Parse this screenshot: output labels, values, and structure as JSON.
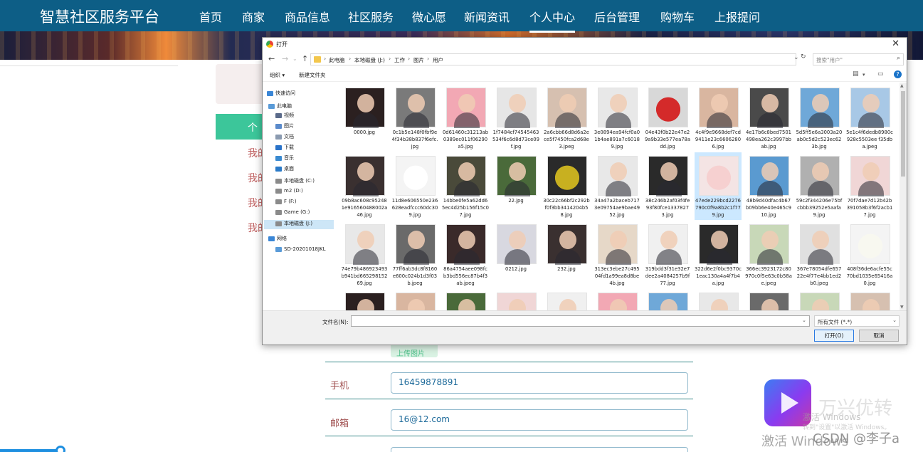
{
  "site": {
    "logo": "智慧社区服务平台",
    "nav": [
      "首页",
      "商家",
      "商品信息",
      "社区服务",
      "微心愿",
      "新闻资讯",
      "个人中心",
      "后台管理",
      "购物车",
      "上报提问"
    ],
    "active_nav": "个人中心",
    "side_green_label": "个",
    "side_links": [
      "我的",
      "我的",
      "我的",
      "我的"
    ],
    "upload_label": "上传图片",
    "form": [
      {
        "label": "手机",
        "value": "16459878891"
      },
      {
        "label": "邮箱",
        "value": "16@12.com"
      }
    ]
  },
  "dialog": {
    "title": "打开",
    "breadcrumb": [
      "此电脑",
      "本地磁盘 (J:)",
      "工作",
      "图片",
      "用户"
    ],
    "search_placeholder": "搜索\"用户\"",
    "toolbar": {
      "organize": "组织 ▾",
      "new_folder": "新建文件夹"
    },
    "nav_pane": [
      {
        "label": "快速访问",
        "icon": "star-icon",
        "color": "#3a86d6"
      },
      {
        "label": "此电脑",
        "icon": "computer-icon",
        "color": "#5a9bd8"
      },
      {
        "label": "视频",
        "icon": "video-icon",
        "color": "#5a6a8a"
      },
      {
        "label": "图片",
        "icon": "picture-icon",
        "color": "#5a8acb"
      },
      {
        "label": "文档",
        "icon": "document-icon",
        "color": "#8a9ab0"
      },
      {
        "label": "下载",
        "icon": "download-icon",
        "color": "#2a73c9"
      },
      {
        "label": "音乐",
        "icon": "music-icon",
        "color": "#3a8ad0"
      },
      {
        "label": "桌面",
        "icon": "desktop-icon",
        "color": "#2a7ac8"
      },
      {
        "label": "本地磁盘 (C:)",
        "icon": "drive-icon",
        "color": "#8a8a8a"
      },
      {
        "label": "m2 (D:)",
        "icon": "drive-icon",
        "color": "#8a8a8a"
      },
      {
        "label": "F (F:)",
        "icon": "drive-icon",
        "color": "#8a8a8a"
      },
      {
        "label": "Game (G:)",
        "icon": "drive-icon",
        "color": "#8a8a8a"
      },
      {
        "label": "本地磁盘 (J:)",
        "icon": "drive-icon",
        "color": "#8a8a8a"
      },
      {
        "label": "网络",
        "icon": "network-icon",
        "color": "#3a86d6"
      },
      {
        "label": "SD-20201018JKL",
        "icon": "computer-icon",
        "color": "#5a9bd8"
      }
    ],
    "selected_nav_index": 12,
    "files": [
      {
        "name": "0000.jpg",
        "color": "#2b2020"
      },
      {
        "name": "0c1b5e148f0fbf9e4f34b38b837f6efc.jpg",
        "color": "#7a7a7a"
      },
      {
        "name": "0d61460c31213ab0389ec011f06290a5.jpg",
        "color": "#f2a8b4"
      },
      {
        "name": "1f7484cf74545463534f6c6d8d73ce09f.jpg",
        "color": "#e6e6e6"
      },
      {
        "name": "2a6cbb66d8d6a2ece5f7450fca2d68e3.jpeg",
        "color": "#d6c0b0"
      },
      {
        "name": "3e0894ea94fcf0a01b4ae891a7c60189.jpg",
        "color": "#e8e8e8"
      },
      {
        "name": "04e43f0b22e47e29a9b33e577ea78add.jpg",
        "color": "#d8d8d8",
        "cartoon": "#d42a2a"
      },
      {
        "name": "4c4f9e9668def7cd9411e23c66062806.jpg",
        "color": "#d9b6a0"
      },
      {
        "name": "4e17b6c8bed7501498ea262c3997bbab.jpg",
        "color": "#4a4a4a"
      },
      {
        "name": "5d5ff5e6a3003a20ab0c5d2c523ec623b.jpg",
        "color": "#6fa8d8"
      },
      {
        "name": "5e1c4f6dedb8980c928c5503ee f35dba.jpeg",
        "color": "#a8c8e6"
      },
      {
        "name": "09b8ac608c952481e916560488002a46.jpg",
        "color": "#3a3030"
      },
      {
        "name": "11d8e606550e236628eadfccc60dc309.jpg",
        "color": "#f4f4f4",
        "cartoon": "#ffffff"
      },
      {
        "name": "14bbe0fe5a62dd65ec4d25b156f15c07.jpg",
        "color": "#4a4a3a"
      },
      {
        "name": "22.jpg",
        "color": "#4a6a3a"
      },
      {
        "name": "30c22c66bf2c292bf0f3bb3414204b58.jpg",
        "color": "#2a2a2a",
        "cartoon": "#c8b020"
      },
      {
        "name": "34a47a2baceb7173e09754ae9bae4952.jpg",
        "color": "#e8e8e8"
      },
      {
        "name": "38c246b2af03f4fe93f80fce13378273.jpg",
        "color": "#2a2a2a"
      },
      {
        "name": "47ede229bcd2276790c0f9a8b2c1f779.jpg",
        "color": "#f4e4e4",
        "cartoon": "#f6d0d0"
      },
      {
        "name": "48b9d40dfac4b67b09bb6e40e465c910.jpg",
        "color": "#5a9ad0"
      },
      {
        "name": "59c2f344206e75bfcbbb39252e5aafa9.jpg",
        "color": "#b0b0b0"
      },
      {
        "name": "70f7dae7d12b42b391058b3f6f2acb17.jpg",
        "color": "#f0d6d6"
      },
      {
        "name": "74e79b486923493b941bd66529815269.jpg",
        "color": "#e8e8e8"
      },
      {
        "name": "77ff6ab3dc8f8160e600c024b1d3f03b.jpeg",
        "color": "#6a6a6a"
      },
      {
        "name": "86a4754aee098fcb3bd556ec87b4f3ab.jpeg",
        "color": "#3a2a2a"
      },
      {
        "name": "0212.jpg",
        "color": "#d8d8e0"
      },
      {
        "name": "232.jpg",
        "color": "#3a3030"
      },
      {
        "name": "313ec3ebe27c49504fd1a99ea8d8be4b.jpg",
        "color": "#e6d8c8"
      },
      {
        "name": "319bdd3f31e32e7dee2a4084257b9f77.jpg",
        "color": "#f0f0f0"
      },
      {
        "name": "322d6e2f0bc9370c1eac130a4a4f7b4a.jpg",
        "color": "#2a2a2a"
      },
      {
        "name": "366ec3923172c80970c0f5e63c0b58ae.jpeg",
        "color": "#c8d8b8"
      },
      {
        "name": "367e78054dfe65722e4f77e4bb1ed2b0.jpeg",
        "color": "#e0e0e0"
      },
      {
        "name": "408f36de6acfe55c70bd1035e65416a0.jpg",
        "color": "#f4f4f4",
        "cartoon": "#f8f8f0"
      }
    ],
    "selected_file_index": 18,
    "file_name_label": "文件名(N):",
    "file_type": "所有文件 (*.*)",
    "open_label": "打开(O)",
    "cancel_label": "取消"
  },
  "watermark": {
    "brand": "万兴优转",
    "activate_small": "激活 Windows",
    "activate_sub": "转到\"设置\"以激活 Windows。",
    "activate": "激活 Windows",
    "csdn": "CSDN @李子a"
  }
}
